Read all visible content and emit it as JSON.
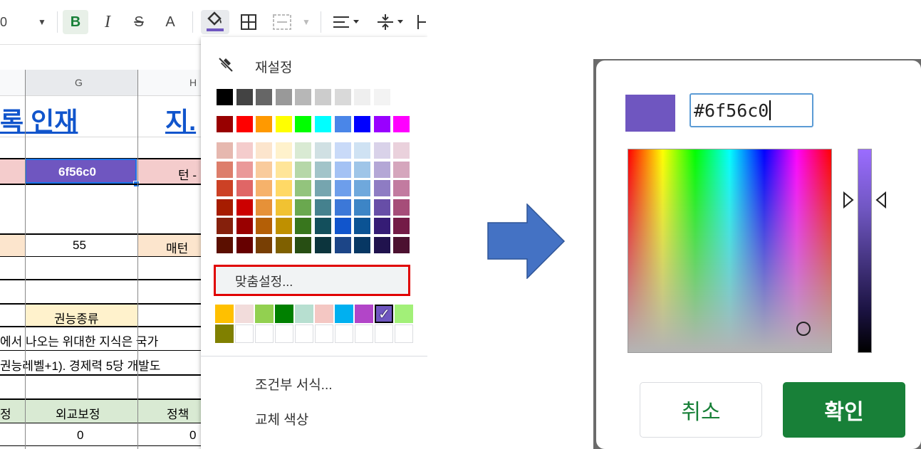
{
  "toolbar": {
    "font_size_fragment": "0",
    "bold_label": "B",
    "italic_label": "I",
    "strike_label": "S",
    "text_color_label": "A"
  },
  "sheet": {
    "columns": [
      "G",
      "H"
    ],
    "title_left": "록 인재",
    "title_right": "지.",
    "hex_cell": "6f56c0",
    "hex_right_fragment": "턴 -",
    "row_value": "55",
    "row_label_fragment": "매턴",
    "ability_label": "권능종류",
    "desc_line1": "에서 나오는 위대한 지식은 국가",
    "desc_line2": "권능레벨+1). 경제력 5당 개발도",
    "bottom_left_fragment": "정",
    "bottom_header_g": "외교보정",
    "bottom_header_h": "정책",
    "bottom_value_g": "0",
    "bottom_value_h": "0"
  },
  "color_menu": {
    "reset_label": "재설정",
    "custom_label": "맞춤설정...",
    "conditional_label": "조건부 서식...",
    "alternating_label": "교체 색상",
    "custom_selected_mark": "✓",
    "grays": [
      "#000000",
      "#434343",
      "#666666",
      "#999999",
      "#b7b7b7",
      "#cccccc",
      "#d9d9d9",
      "#efefef",
      "#f3f3f3",
      "#ffffff"
    ],
    "brights": [
      "#980000",
      "#ff0000",
      "#ff9900",
      "#ffff00",
      "#00ff00",
      "#00ffff",
      "#4a86e8",
      "#0000ff",
      "#9900ff",
      "#ff00ff"
    ],
    "shades": [
      [
        "#e6b8af",
        "#f4cccc",
        "#fce5cd",
        "#fff2cc",
        "#d9ead3",
        "#d0e0e3",
        "#c9daf8",
        "#cfe2f3",
        "#d9d2e9",
        "#ead1dc"
      ],
      [
        "#dd7e6b",
        "#ea9999",
        "#f9cb9c",
        "#ffe599",
        "#b6d7a8",
        "#a2c4c9",
        "#a4c2f4",
        "#9fc5e8",
        "#b4a7d6",
        "#d5a6bd"
      ],
      [
        "#cc4125",
        "#e06666",
        "#f6b26b",
        "#ffd966",
        "#93c47d",
        "#76a5af",
        "#6d9eeb",
        "#6fa8dc",
        "#8e7cc3",
        "#c27ba0"
      ],
      [
        "#a61c00",
        "#cc0000",
        "#e69138",
        "#f1c232",
        "#6aa84f",
        "#45818e",
        "#3c78d8",
        "#3d85c6",
        "#674ea7",
        "#a64d79"
      ],
      [
        "#85200c",
        "#990000",
        "#b45f06",
        "#bf9000",
        "#38761d",
        "#134f5c",
        "#1155cc",
        "#0b5394",
        "#351c75",
        "#741b47"
      ],
      [
        "#5b0f00",
        "#660000",
        "#783f04",
        "#7f6000",
        "#274e13",
        "#0c343d",
        "#1c4587",
        "#073763",
        "#20124d",
        "#4c1130"
      ]
    ],
    "custom_colors": [
      "#ffc000",
      "#f2dcdb",
      "#92d050",
      "#008000",
      "#b7dfd0",
      "#f4c7c3",
      "#00b0f0",
      "#b245c8",
      "#6f56c0",
      "#a2f078",
      "#808000"
    ]
  },
  "dialog": {
    "hex_value": "#6f56c0",
    "preview_color": "#6f56c0",
    "cancel_label": "취소",
    "ok_label": "확인"
  },
  "colors": {
    "accent_green": "#188038",
    "arrow_blue": "#4472c4",
    "highlight_red": "#e00000",
    "header_pink": "#f4cccc",
    "header_orange": "#fce5cd",
    "header_yellow": "#fff2cc",
    "header_green": "#d9ead3",
    "title_blue": "#1155cc"
  }
}
